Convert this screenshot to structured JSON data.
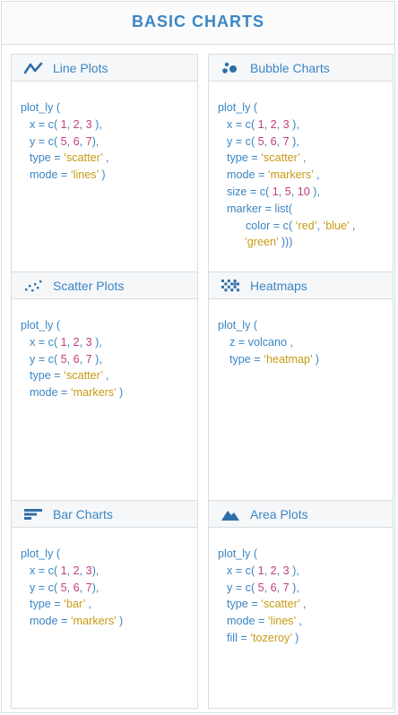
{
  "page": {
    "title": "BASIC CHARTS"
  },
  "cards": {
    "line": {
      "title": "Line Plots",
      "icon": "line-chart-icon",
      "lines": [
        [
          "plot_ly ("
        ],
        [
          "x = c( ",
          "1",
          ", ",
          "2",
          ", ",
          "3",
          " ),"
        ],
        [
          "y = c( ",
          "5",
          ", ",
          "6",
          ", ",
          "7",
          "),"
        ],
        [
          "type = ",
          "'scatter'",
          " ,"
        ],
        [
          "mode = ",
          "'lines'",
          " )"
        ]
      ]
    },
    "bubble": {
      "title": "Bubble Charts",
      "icon": "bubble-chart-icon",
      "lines": [
        [
          "plot_ly ("
        ],
        [
          "x = c( ",
          "1",
          ", ",
          "2",
          ", ",
          "3",
          " ),"
        ],
        [
          "y = c( ",
          "5",
          ", ",
          "6",
          ", ",
          "7",
          " ),"
        ],
        [
          "type = ",
          "'scatter'",
          " ,"
        ],
        [
          "mode = ",
          "'markers'",
          " ,"
        ],
        [
          "size = c( ",
          "1",
          ", ",
          "5",
          ", ",
          "10",
          " ),"
        ],
        [
          "marker = list("
        ],
        [
          "color = c( ",
          "'red'",
          ", ",
          "'blue'",
          " ,"
        ],
        [
          "'green'",
          " )))"
        ]
      ]
    },
    "scatter": {
      "title": "Scatter Plots",
      "icon": "scatter-plot-icon",
      "lines": [
        [
          "plot_ly ("
        ],
        [
          "x = c( ",
          "1",
          ", ",
          "2",
          ", ",
          "3",
          " ),"
        ],
        [
          "y = c( ",
          "5",
          ", ",
          "6",
          ", ",
          "7",
          " ),"
        ],
        [
          "type = ",
          "'scatter'",
          " ,"
        ],
        [
          "mode = ",
          "'markers'",
          " )"
        ]
      ]
    },
    "heatmap": {
      "title": "Heatmaps",
      "icon": "heatmap-icon",
      "lines": [
        [
          "plot_ly ("
        ],
        [
          "z = volcano ,"
        ],
        [
          "type = ",
          "'heatmap'",
          " )"
        ]
      ]
    },
    "bar": {
      "title": "Bar Charts",
      "icon": "bar-chart-icon",
      "lines": [
        [
          "plot_ly ("
        ],
        [
          "x = c( ",
          "1",
          ", ",
          "2",
          ", ",
          "3",
          "),"
        ],
        [
          "y = c( ",
          "5",
          ", ",
          "6",
          ", ",
          "7",
          "),"
        ],
        [
          "type = ",
          "'bar'",
          " ,"
        ],
        [
          "mode = ",
          "'markers'",
          " )"
        ]
      ]
    },
    "area": {
      "title": "Area Plots",
      "icon": "area-chart-icon",
      "lines": [
        [
          "plot_ly ("
        ],
        [
          "x = c( ",
          "1",
          ", ",
          "2",
          ", ",
          "3",
          " ),"
        ],
        [
          "y = c( ",
          "5",
          ", ",
          "6",
          ", ",
          "7",
          " ),"
        ],
        [
          "type = ",
          "'scatter'",
          " ,"
        ],
        [
          "mode = ",
          "'lines'",
          " ,"
        ],
        [
          "fill = ",
          "'tozeroy'",
          " )"
        ]
      ]
    }
  },
  "colors": {
    "accent": "#3b86c4",
    "number": "#c0407a",
    "string": "#c89a14",
    "border": "#d9dde1"
  }
}
